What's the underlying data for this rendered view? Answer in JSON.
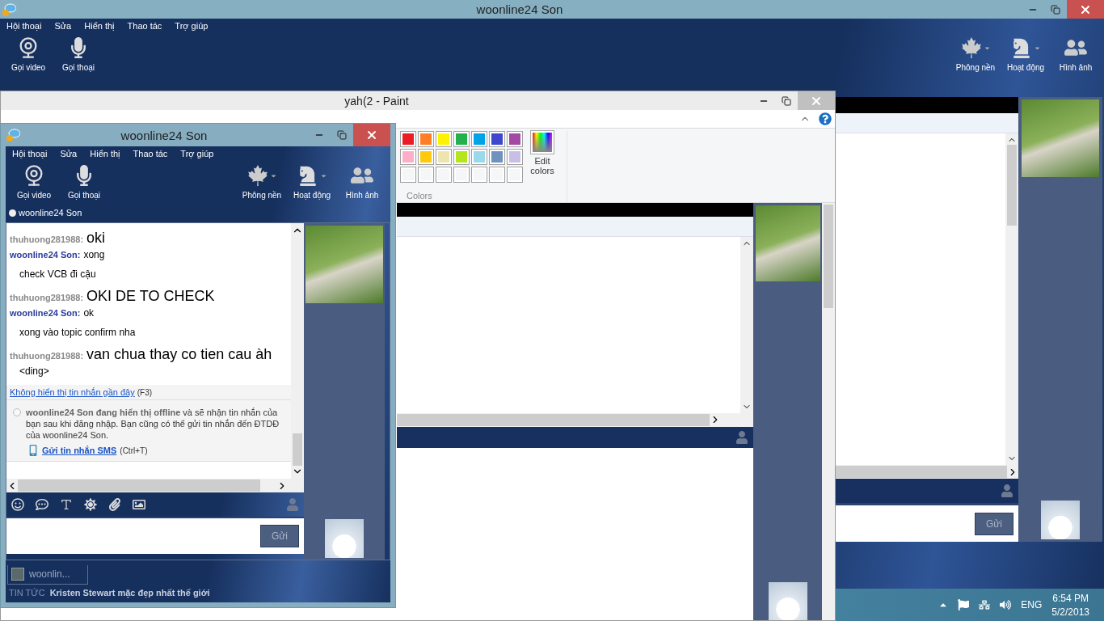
{
  "main_window": {
    "title": "woonline24 Son",
    "menu": [
      "Hội thoại",
      "Sửa",
      "Hiển thị",
      "Thao tác",
      "Trợ giúp"
    ],
    "tools_left": [
      {
        "label": "Gọi video",
        "kind": "webcam",
        "dropdown": false
      },
      {
        "label": "Gọi thoại",
        "kind": "mic",
        "dropdown": false
      }
    ],
    "tools_right": [
      {
        "label": "Phông nền",
        "kind": "leaf",
        "dropdown": true
      },
      {
        "label": "Hoạt động",
        "kind": "knight",
        "dropdown": true
      },
      {
        "label": "Hình ảnh",
        "kind": "photo",
        "dropdown": false
      }
    ],
    "send_button": "Gửi"
  },
  "paint_window": {
    "title": "yah(2 - Paint",
    "palette": [
      [
        {
          "color": "#ed1c24"
        },
        {
          "color": "#ff7f27"
        },
        {
          "color": "#fff200"
        },
        {
          "color": "#22b14c"
        },
        {
          "color": "#00a2e8"
        },
        {
          "color": "#3f48cc"
        },
        {
          "color": "#a349a4"
        }
      ],
      [
        {
          "color": "#ffaec9"
        },
        {
          "color": "#ffc90e"
        },
        {
          "color": "#efe4b0"
        },
        {
          "color": "#b5e61d"
        },
        {
          "color": "#99d9ea"
        },
        {
          "color": "#7092be"
        },
        {
          "color": "#c8bfe7"
        }
      ],
      [
        {
          "color": "#f5f6f7"
        },
        {
          "color": "#f5f6f7"
        },
        {
          "color": "#f5f6f7"
        },
        {
          "color": "#f5f6f7"
        },
        {
          "color": "#f5f6f7"
        },
        {
          "color": "#f5f6f7"
        },
        {
          "color": "#f5f6f7"
        }
      ]
    ],
    "edit_colors": "Edit colors",
    "group_label": "Colors"
  },
  "chat_window": {
    "title": "woonline24 Son",
    "menu": [
      "Hội thoại",
      "Sửa",
      "Hiển thị",
      "Thao tác",
      "Trợ giúp"
    ],
    "tools_left": [
      {
        "label": "Gọi video",
        "kind": "webcam",
        "dropdown": false
      },
      {
        "label": "Gọi thoại",
        "kind": "mic",
        "dropdown": false
      }
    ],
    "tools_right": [
      {
        "label": "Phông nền",
        "kind": "leaf",
        "dropdown": true
      },
      {
        "label": "Hoạt động",
        "kind": "knight",
        "dropdown": true
      },
      {
        "label": "Hình ảnh",
        "kind": "photo",
        "dropdown": false
      }
    ],
    "contact": "woonline24 Son",
    "messages": [
      {
        "kind": "them",
        "sender": "thuhuong281988:",
        "text": "oki"
      },
      {
        "kind": "me",
        "sender": "woonline24 Son:",
        "text": "xong"
      },
      {
        "kind": "line",
        "text": "check VCB đi cậu"
      },
      {
        "kind": "them",
        "sender": "thuhuong281988:",
        "text": "OKI DE TO CHECK"
      },
      {
        "kind": "me",
        "sender": "woonline24 Son:",
        "text": "ok"
      },
      {
        "kind": "line",
        "text": "xong vào topic confirm nha"
      },
      {
        "kind": "them",
        "sender": "thuhuong281988:",
        "text": "van chua thay co tien cau àh"
      },
      {
        "kind": "line",
        "text": "<ding>"
      }
    ],
    "recent_link": "Không hiển thị tin nhắn gần đây",
    "recent_shortcut": "(F3)",
    "offline_notice": "**woonline24 Son đang hiển thị offline** và sẽ nhận tin nhắn của bạn sau khi đăng nhập. Bạn cũng có thể gửi tin nhắn đến ĐTDĐ của woonline24 Son.",
    "sms_link": "Gửi tin nhắn SMS",
    "sms_shortcut": "(Ctrl+T)",
    "send_button": "Gửi",
    "tab": "woonlin...",
    "news_label": "TIN TỨC",
    "news": "Kristen Stewart mặc đẹp nhất thế giới"
  },
  "taskbar": {
    "language": "ENG",
    "time": "6:54 PM",
    "date": "5/2/2013"
  }
}
